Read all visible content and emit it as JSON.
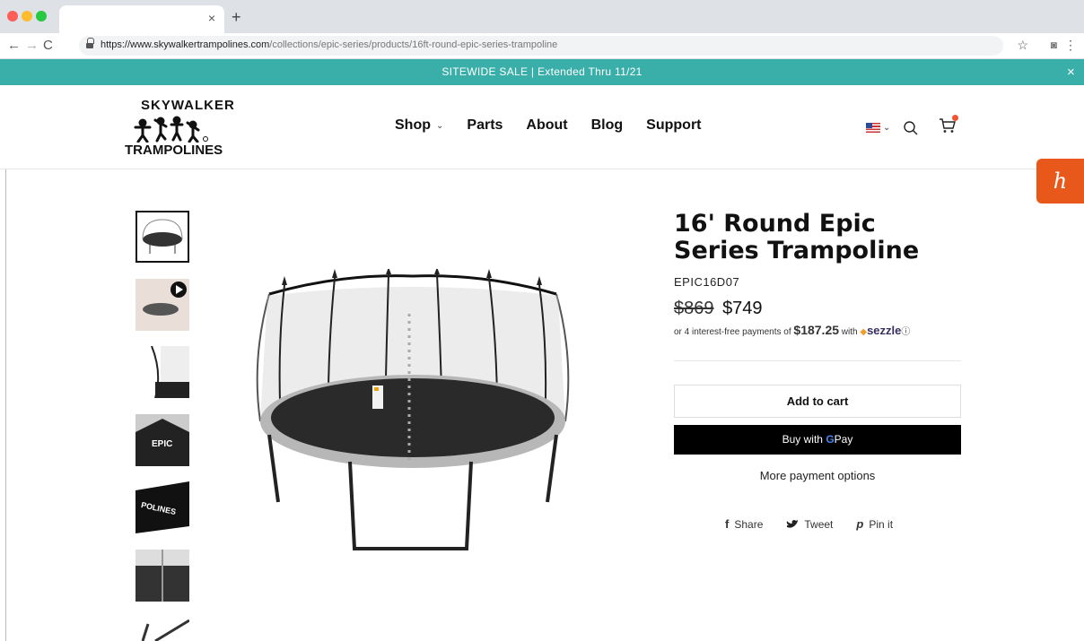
{
  "browser": {
    "url_host": "https://www.skywalkertrampolines.com",
    "url_path": "/collections/epic-series/products/16ft-round-epic-series-trampoline"
  },
  "announcement": {
    "text": "SITEWIDE SALE | Extended Thru 11/21"
  },
  "header": {
    "logo_top": "SKYWALKER",
    "logo_bottom": "TRAMPOLINES",
    "nav": [
      {
        "label": "Shop"
      },
      {
        "label": "Parts"
      },
      {
        "label": "About"
      },
      {
        "label": "Blog"
      },
      {
        "label": "Support"
      }
    ]
  },
  "honey": {
    "letter": "h"
  },
  "product": {
    "title": "16' Round Epic Series Trampoline",
    "sku": "EPIC16D07",
    "price_old": "$869",
    "price_new": "$749",
    "installments_prefix": "or 4 interest-free payments of",
    "installment_amount": "$187.25",
    "installments_with": "with",
    "sezzle_brand": "sezzle",
    "add_to_cart": "Add to cart",
    "gpay_prefix": "Buy with",
    "gpay_brand": "G",
    "gpay_suffix": "Pay",
    "more_payment": "More payment options"
  },
  "share": [
    {
      "icon": "facebook-icon",
      "label": "Share"
    },
    {
      "icon": "twitter-icon",
      "label": "Tweet"
    },
    {
      "icon": "pinterest-icon",
      "label": "Pin it"
    }
  ],
  "colors": {
    "announcement_bg": "#3aafa9",
    "honey_bg": "#e8581a",
    "cart_badge": "#e53"
  }
}
